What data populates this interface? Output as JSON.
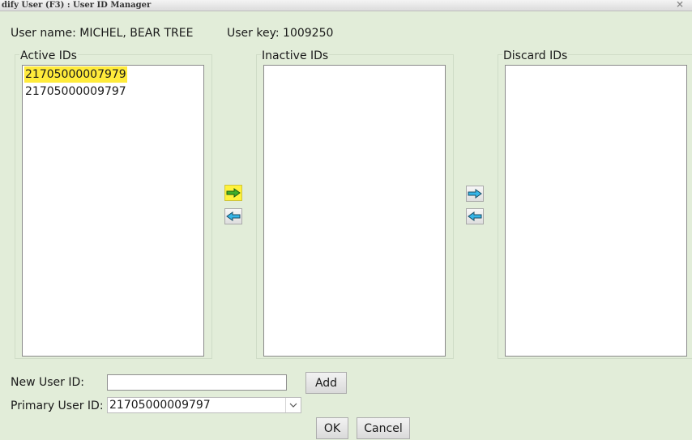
{
  "window": {
    "title": "dify User (F3) : User ID Manager"
  },
  "user": {
    "name_label": "User name:",
    "name_value": "MICHEL, BEAR TREE",
    "key_label": "User key:",
    "key_value": "1009250"
  },
  "lists": {
    "active": {
      "label": "Active IDs",
      "items": [
        "21705000007979",
        "21705000009797"
      ],
      "selected_index": 0
    },
    "inactive": {
      "label": "Inactive IDs",
      "items": []
    },
    "discard": {
      "label": "Discard IDs",
      "items": []
    }
  },
  "form": {
    "new_user_id_label": "New User ID:",
    "new_user_id_value": "",
    "add_label": "Add",
    "primary_user_id_label": "Primary User ID:",
    "primary_user_id_value": "21705000009797"
  },
  "footer": {
    "ok_label": "OK",
    "cancel_label": "Cancel"
  },
  "colors": {
    "background": "#e2edd9",
    "highlight": "#ffeb3b",
    "arrow_green": "#3fae2a",
    "arrow_blue": "#35b6e8"
  },
  "icons": [
    "arrow-right-icon",
    "arrow-left-icon",
    "chevron-down-icon",
    "close-icon"
  ]
}
